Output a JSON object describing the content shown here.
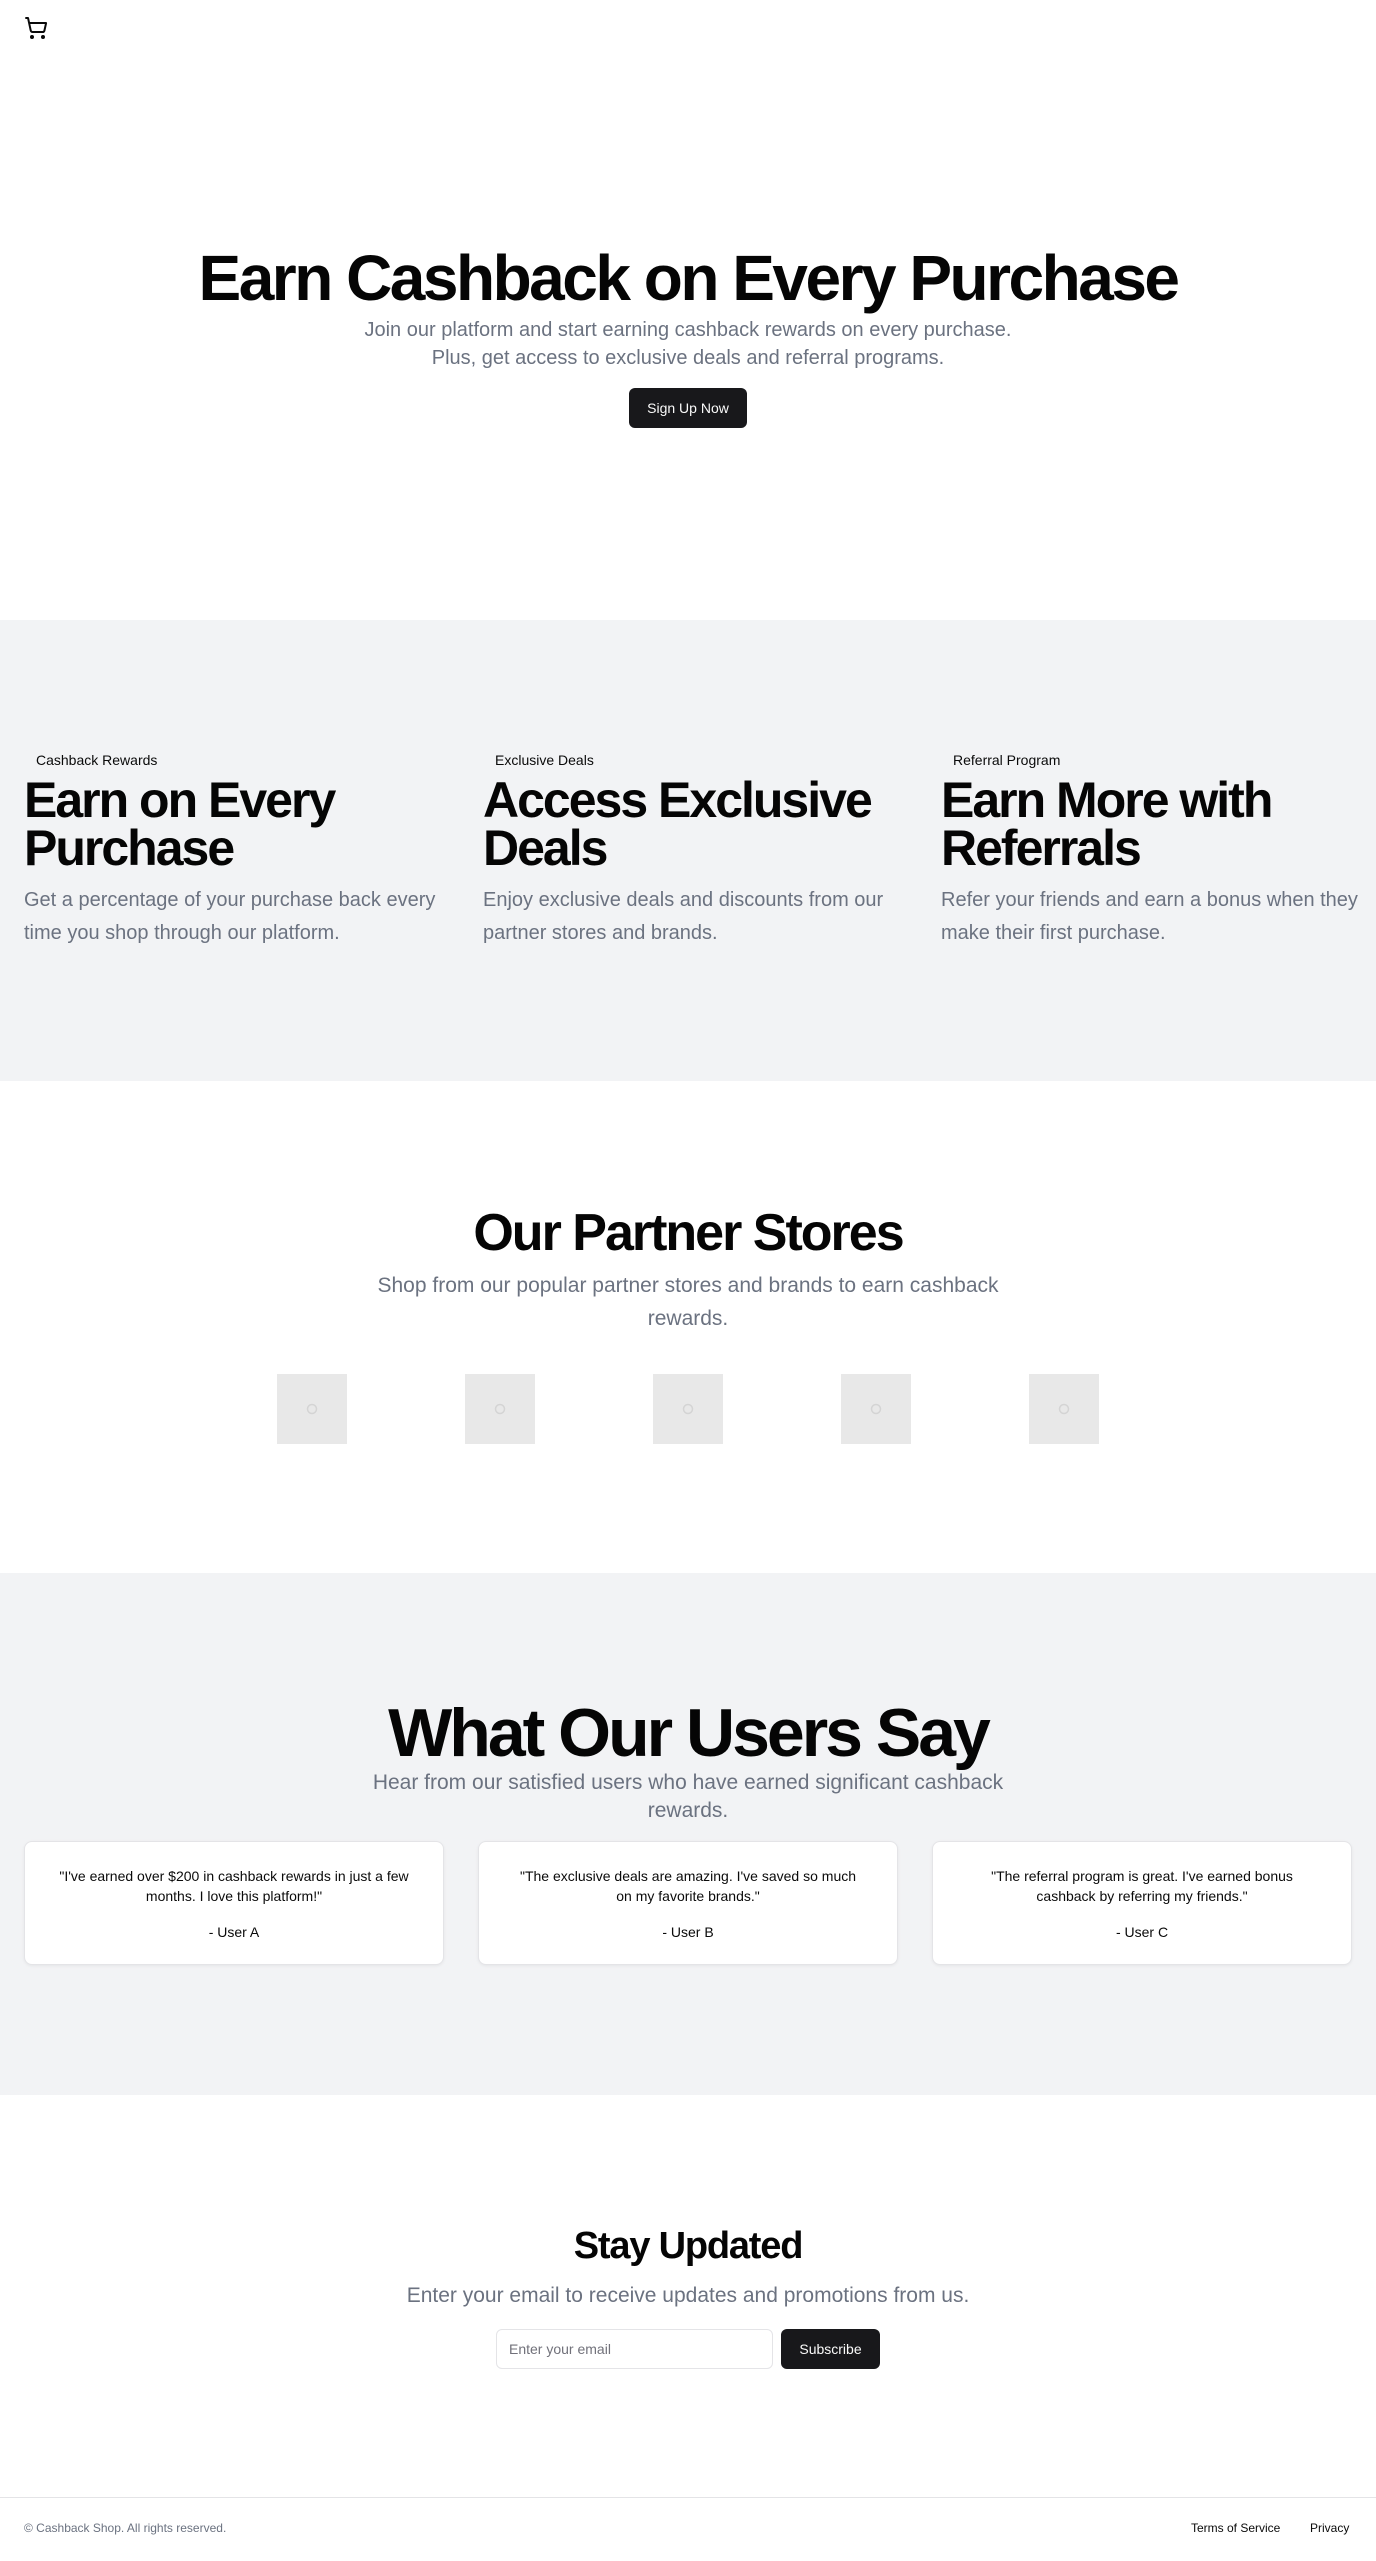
{
  "header": {
    "cart_icon": "shopping-cart-icon"
  },
  "hero": {
    "title": "Earn Cashback on Every Purchase",
    "subtitle_line1": "Join our platform and start earning cashback rewards on every purchase.",
    "subtitle_line2": "Plus, get access to exclusive deals and referral programs.",
    "cta_label": "Sign Up Now"
  },
  "features": [
    {
      "badge": "Cashback Rewards",
      "title": "Earn on Every Purchase",
      "description": "Get a percentage of your purchase back every time you shop through our platform."
    },
    {
      "badge": "Exclusive Deals",
      "title": "Access Exclusive Deals",
      "description": "Enjoy exclusive deals and discounts from our partner stores and brands."
    },
    {
      "badge": "Referral Program",
      "title": "Earn More with Referrals",
      "description": "Refer your friends and earn a bonus when they make their first purchase."
    }
  ],
  "partners": {
    "title": "Our Partner Stores",
    "subtitle": "Shop from our popular partner stores and brands to earn cashback rewards.",
    "logos": [
      "image-placeholder-icon",
      "image-placeholder-icon",
      "image-placeholder-icon",
      "image-placeholder-icon",
      "image-placeholder-icon"
    ]
  },
  "testimonials": {
    "title": "What Our Users Say",
    "subtitle": "Hear from our satisfied users who have earned significant cashback rewards.",
    "items": [
      {
        "quote": "\"I've earned over $200 in cashback rewards in just a few months. I love this platform!\"",
        "author": "- User A"
      },
      {
        "quote": "\"The exclusive deals are amazing. I've saved so much on my favorite brands.\"",
        "author": "- User B"
      },
      {
        "quote": "\"The referral program is great. I've earned bonus cashback by referring my friends.\"",
        "author": "- User C"
      }
    ]
  },
  "newsletter": {
    "title": "Stay Updated",
    "subtitle": "Enter your email to receive updates and promotions from us.",
    "email_placeholder": "Enter your email",
    "email_value": "",
    "subscribe_label": "Subscribe"
  },
  "footer": {
    "copyright": "© Cashback Shop. All rights reserved.",
    "links": [
      "Terms of Service",
      "Privacy"
    ]
  },
  "colors": {
    "primary_button": "#18181b",
    "muted_text": "#6b7280",
    "section_bg": "#f2f3f5",
    "placeholder_box": "#e8e8e8"
  }
}
